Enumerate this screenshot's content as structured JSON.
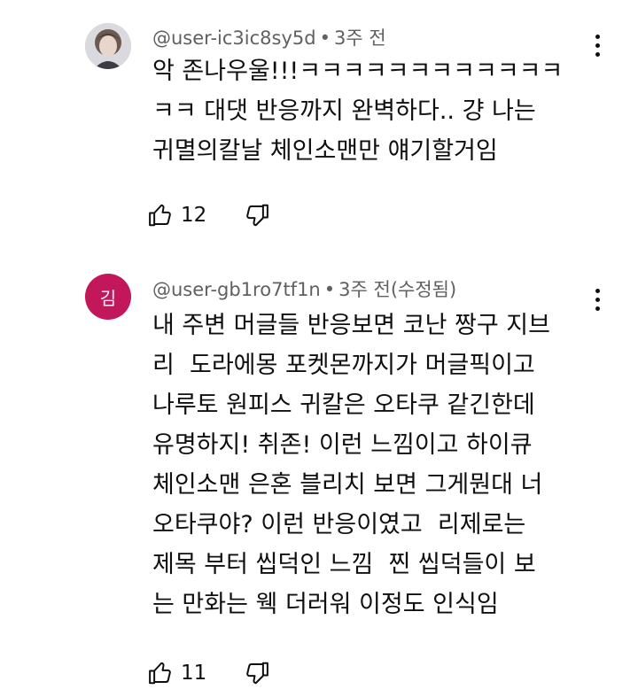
{
  "comments": [
    {
      "author": "@user-ic3ic8sy5d",
      "time": "3주 전",
      "edited": "",
      "avatar_type": "photo",
      "avatar_initial": "",
      "text": "악 존나우울!!!ㅋㅋㅋㅋㅋㅋㅋㅋㅋㅋㅋㅋ\nㅋㅋ 대댓 반응까지 완벽하다.. 걍 나는\n귀멸의칼날 체인소맨만 얘기할거임",
      "likes": "12",
      "icons": [
        "thumbs-up-icon",
        "thumbs-down-icon",
        "more-vert-icon"
      ]
    },
    {
      "author": "@user-gb1ro7tf1n",
      "time": "3주 전",
      "edited": "(수정됨)",
      "avatar_type": "initial",
      "avatar_initial": "김",
      "avatar_color": "#c2185b",
      "text": "내 주변 머글들 반응보면 코난 짱구 지브\n리  도라에몽 포켓몬까지가 머글픽이고\n나루토 원피스 귀칼은 오타쿠 같긴한데\n유명하지! 취존! 이런 느낌이고 하이큐\n체인소맨 은혼 블리치 보면 그게뭔대 너\n오타쿠야? 이런 반응이였고  리제로는\n제목 부터 씹덕인 느낌  찐 씹덕들이 보\n는 만화는 웩 더러워 이정도 인식임",
      "likes": "11",
      "icons": [
        "thumbs-up-icon",
        "thumbs-down-icon",
        "more-vert-icon"
      ]
    }
  ],
  "separator": "•"
}
